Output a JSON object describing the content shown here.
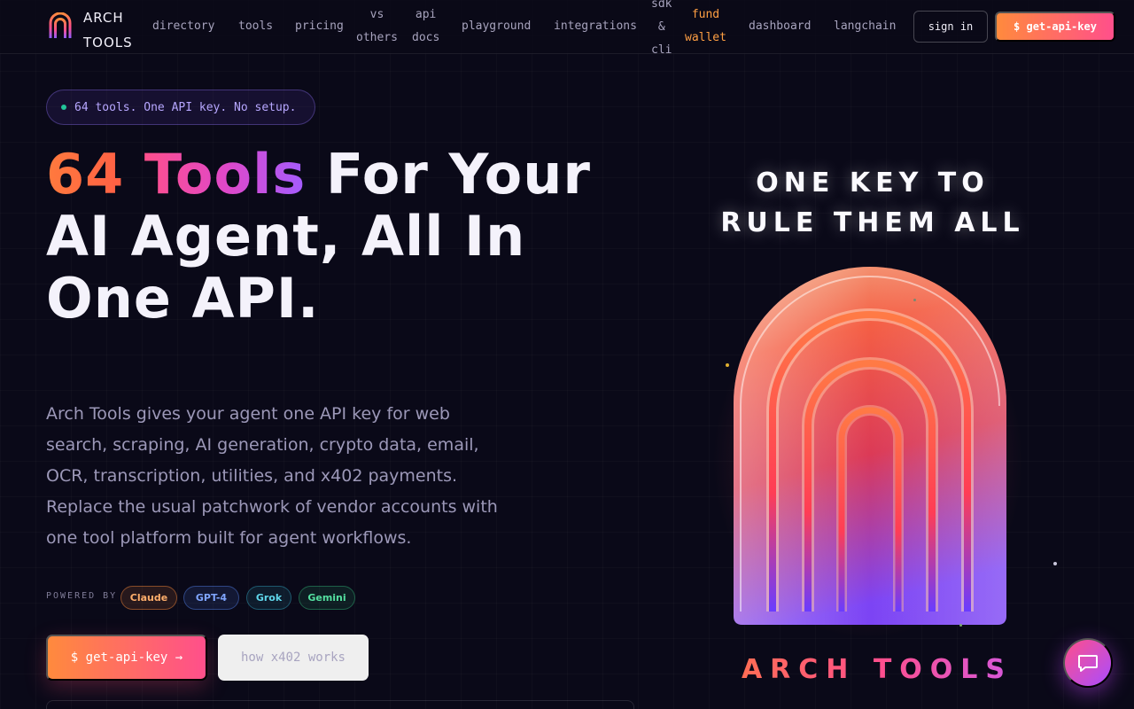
{
  "nav": {
    "logo_text": "ARCH\nTOOLS",
    "links": [
      {
        "label": "directory"
      },
      {
        "label": "tools"
      },
      {
        "label": "pricing"
      },
      {
        "label": "vs\nothers"
      },
      {
        "label": "api\ndocs"
      },
      {
        "label": "playground"
      },
      {
        "label": "integrations"
      },
      {
        "label": "sdk\n&\ncli"
      },
      {
        "label": "fund\nwallet"
      },
      {
        "label": "dashboard"
      },
      {
        "label": "langchain"
      }
    ],
    "signin_label": "sign in",
    "get_key_label": "$ get-api-key"
  },
  "hero": {
    "pill_text": "64 tools. One API key. No setup.",
    "headline_num": "64",
    "headline_tools": "Tools",
    "headline_rest": " For Your AI Agent, All In One API.",
    "description": "Arch Tools gives your agent one API key for web search, scraping, AI generation, crypto data, email, OCR, transcription, utilities, and x402 payments. Replace the usual patchwork of vendor accounts with one tool platform built for agent workflows.",
    "powered_by_label": "POWERED BY",
    "models": [
      "Claude",
      "GPT-4",
      "Grok",
      "Gemini"
    ],
    "cta_primary": "$ get-api-key →",
    "cta_secondary": "how x402 works"
  },
  "showcase": {
    "tagline_line1": "ONE KEY TO",
    "tagline_line2": "RULE THEM ALL",
    "brand": "ARCH TOOLS"
  },
  "colors": {
    "accent_orange": "#ff8a3d",
    "accent_pink": "#ff4f8b",
    "accent_purple": "#a35cff",
    "background": "#0a0918"
  },
  "icons": {
    "logo": "arch-logo-icon",
    "chat": "chat-bubble-icon"
  }
}
